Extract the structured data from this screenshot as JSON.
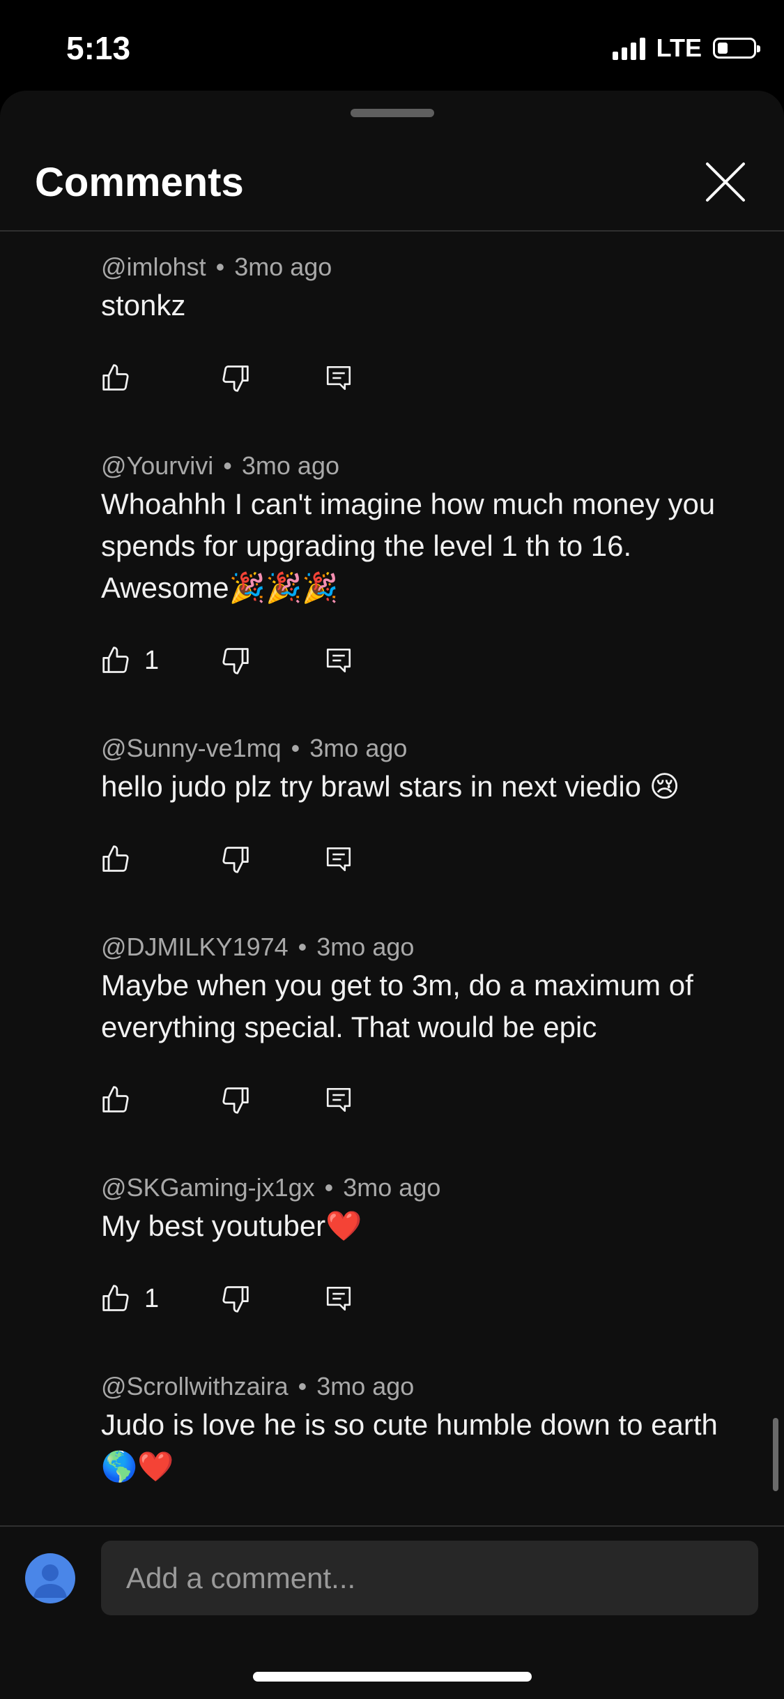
{
  "status": {
    "time": "5:13",
    "network": "LTE"
  },
  "header": {
    "title": "Comments"
  },
  "comments": [
    {
      "handle": "@imlohst",
      "age": "3mo ago",
      "text": "stonkz",
      "likes": ""
    },
    {
      "handle": "@Yourvivi",
      "age": "3mo ago",
      "text": "Whoahhh I can't imagine how much money you spends for upgrading the level 1 th to 16. Awesome🎉🎉🎉",
      "likes": "1"
    },
    {
      "handle": "@Sunny-ve1mq",
      "age": "3mo ago",
      "text": "hello judo plz try brawl stars in next viedio 😢",
      "likes": ""
    },
    {
      "handle": "@DJMILKY1974",
      "age": "3mo ago",
      "text": "Maybe when you get to 3m, do a maximum of everything special. That would be epic",
      "likes": ""
    },
    {
      "handle": "@SKGaming-jx1gx",
      "age": "3mo ago",
      "text": "My best youtuber❤️",
      "likes": "1"
    },
    {
      "handle": "@Scrollwithzaira",
      "age": "3mo ago",
      "text": "Judo is love he is so cute humble down to earth 🌎❤️",
      "likes": ""
    }
  ],
  "composer": {
    "placeholder": "Add a comment..."
  },
  "icons": {
    "like": "thumbs-up-icon",
    "dislike": "thumbs-down-icon",
    "reply": "reply-icon",
    "close": "close-icon"
  },
  "colors": {
    "background": "#0f0f0f",
    "text": "#f1f1f1",
    "meta": "#a9a9a9",
    "input": "#272727",
    "avatar": "#4a86e8"
  }
}
